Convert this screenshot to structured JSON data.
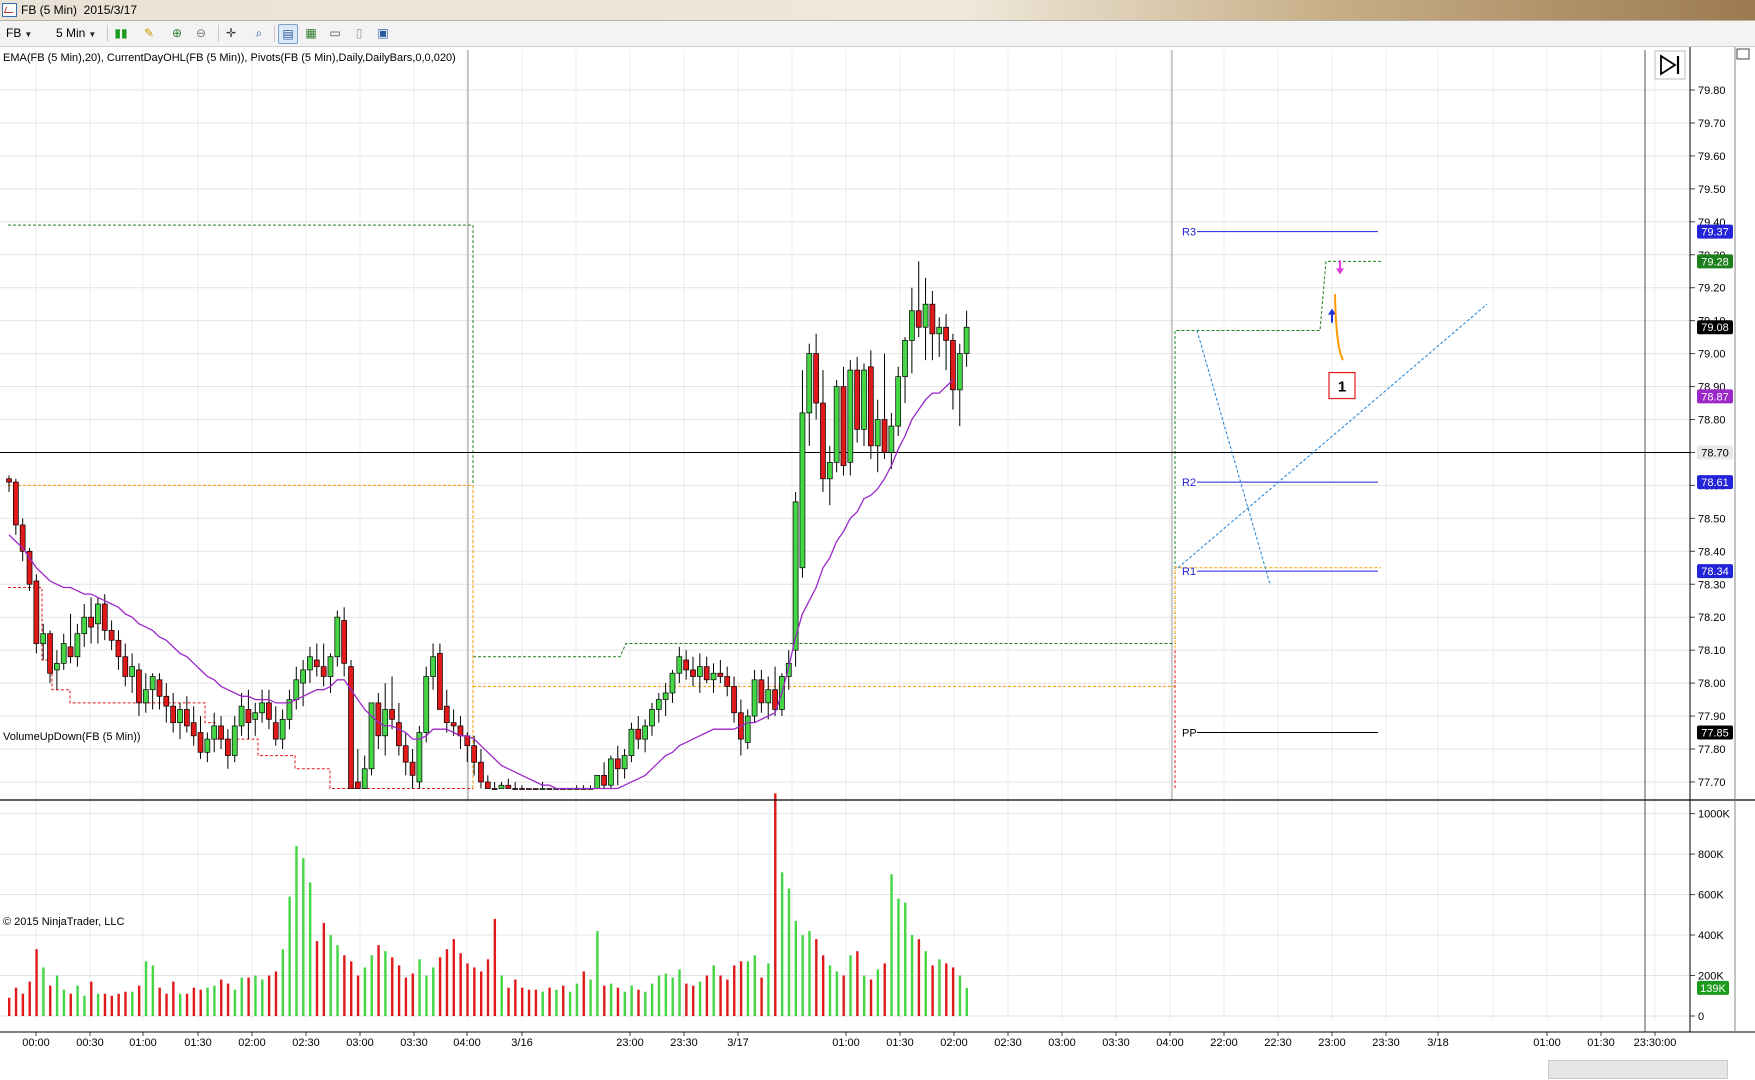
{
  "window": {
    "title": "FB (5 Min)  2015/3/17"
  },
  "toolbar": {
    "instrument": "FB",
    "interval": "5 Min",
    "icons": [
      "bars-type-icon",
      "draw-tool-icon",
      "zoom-in-icon",
      "zoom-out-icon",
      "crosshair-icon",
      "search-icon",
      "properties-icon",
      "tile-icon",
      "chart-trader-icon",
      "data-box-icon",
      "new-window-icon"
    ]
  },
  "price_panel": {
    "indicator_label": "EMA(FB (5 Min),20), CurrentDayOHL(FB (5 Min)), Pivots(FB (5 Min),Daily,DailyBars,0,0,020)"
  },
  "volume_panel": {
    "indicator_label": "VolumeUpDown(FB (5 Min))"
  },
  "copyright": "© 2015 NinjaTrader, LLC",
  "colors": {
    "up": "#44d644",
    "down": "#e0191b",
    "ema": "#9c27c9",
    "pivot": "#2323d9",
    "high_line": "#1b7f1b",
    "low_line": "#e0191b",
    "open_line": "#ff9a00",
    "trend": "#1b7fd6"
  },
  "chart_data": [
    {
      "type": "candlestick",
      "instrument": "FB",
      "interval": "5 Min",
      "ylim": [
        77.68,
        79.92
      ],
      "y_ticks": [
        "79.80",
        "79.70",
        "79.60",
        "79.50",
        "79.40",
        "79.30",
        "79.20",
        "79.10",
        "79.00",
        "78.90",
        "78.80",
        "78.70",
        "78.60",
        "78.50",
        "78.40",
        "78.30",
        "78.20",
        "78.10",
        "78.00",
        "77.90",
        "77.80",
        "77.70"
      ],
      "x_tick_labels": [
        "00:00",
        "00:30",
        "01:00",
        "01:30",
        "02:00",
        "02:30",
        "03:00",
        "03:30",
        "04:00",
        "3/16",
        "23:00",
        "23:30",
        "3/17",
        "01:00",
        "01:30",
        "02:00",
        "02:30",
        "03:00",
        "03:30",
        "04:00",
        "22:00",
        "22:30",
        "23:00",
        "23:30",
        "3/18",
        "01:00",
        "01:30",
        "23:30:00"
      ],
      "last_price": 79.08,
      "horizontal_line": 78.7,
      "pivots": [
        {
          "name": "R3",
          "value": 79.37
        },
        {
          "name": "R2",
          "value": 78.61
        },
        {
          "name": "R1",
          "value": 78.34
        },
        {
          "name": "PP",
          "value": 77.85
        }
      ],
      "current_day": {
        "high": 79.28,
        "open": 78.35
      },
      "ema_value": 78.87,
      "markers": [
        {
          "text": "1"
        }
      ],
      "bars": [
        [
          78.62,
          78.63,
          78.58,
          78.61
        ],
        [
          78.61,
          78.62,
          78.45,
          78.48
        ],
        [
          78.48,
          78.5,
          78.37,
          78.4
        ],
        [
          78.4,
          78.41,
          78.28,
          78.3
        ],
        [
          78.31,
          78.33,
          78.09,
          78.12
        ],
        [
          78.12,
          78.18,
          78.07,
          78.15
        ],
        [
          78.15,
          78.16,
          78.0,
          78.03
        ],
        [
          78.04,
          78.1,
          77.98,
          78.06
        ],
        [
          78.06,
          78.15,
          78.04,
          78.12
        ],
        [
          78.11,
          78.21,
          78.06,
          78.08
        ],
        [
          78.08,
          78.18,
          78.05,
          78.15
        ],
        [
          78.15,
          78.24,
          78.11,
          78.2
        ],
        [
          78.2,
          78.26,
          78.12,
          78.17
        ],
        [
          78.18,
          78.26,
          78.12,
          78.24
        ],
        [
          78.24,
          78.27,
          78.13,
          78.16
        ],
        [
          78.16,
          78.19,
          78.1,
          78.13
        ],
        [
          78.13,
          78.16,
          78.04,
          78.08
        ],
        [
          78.08,
          78.12,
          77.99,
          78.02
        ],
        [
          78.02,
          78.09,
          77.97,
          78.05
        ],
        [
          78.04,
          78.06,
          77.9,
          77.94
        ],
        [
          77.94,
          78.03,
          77.91,
          77.98
        ],
        [
          77.98,
          78.03,
          77.92,
          78.02
        ],
        [
          78.01,
          78.03,
          77.92,
          77.96
        ],
        [
          77.96,
          78.0,
          77.88,
          77.93
        ],
        [
          77.93,
          77.97,
          77.85,
          77.88
        ],
        [
          77.88,
          77.94,
          77.83,
          77.92
        ],
        [
          77.92,
          77.96,
          77.85,
          77.87
        ],
        [
          77.88,
          77.93,
          77.81,
          77.84
        ],
        [
          77.85,
          77.9,
          77.77,
          77.79
        ],
        [
          77.79,
          77.85,
          77.76,
          77.83
        ],
        [
          77.83,
          77.91,
          77.79,
          77.87
        ],
        [
          77.87,
          77.9,
          77.8,
          77.83
        ],
        [
          77.83,
          77.86,
          77.74,
          77.78
        ],
        [
          77.78,
          77.9,
          77.76,
          77.87
        ],
        [
          77.87,
          77.97,
          77.84,
          77.93
        ],
        [
          77.92,
          77.98,
          77.83,
          77.88
        ],
        [
          77.89,
          77.94,
          77.84,
          77.91
        ],
        [
          77.91,
          77.98,
          77.88,
          77.94
        ],
        [
          77.94,
          77.98,
          77.86,
          77.89
        ],
        [
          77.88,
          77.93,
          77.81,
          77.83
        ],
        [
          77.83,
          77.92,
          77.8,
          77.89
        ],
        [
          77.89,
          77.98,
          77.86,
          77.95
        ],
        [
          77.95,
          78.05,
          77.92,
          78.01
        ],
        [
          78.0,
          78.07,
          77.93,
          78.04
        ],
        [
          78.04,
          78.11,
          78.0,
          78.08
        ],
        [
          78.07,
          78.12,
          78.02,
          78.05
        ],
        [
          78.05,
          78.12,
          77.99,
          78.02
        ],
        [
          78.02,
          78.09,
          77.97,
          78.08
        ],
        [
          78.08,
          78.22,
          78.05,
          78.2
        ],
        [
          78.19,
          78.23,
          78.02,
          78.06
        ],
        [
          78.05,
          78.07,
          77.62,
          77.68
        ],
        [
          77.7,
          77.8,
          77.62,
          77.66
        ],
        [
          77.68,
          77.78,
          77.65,
          77.74
        ],
        [
          77.74,
          77.92,
          77.72,
          77.94
        ],
        [
          77.94,
          77.97,
          77.8,
          77.84
        ],
        [
          77.84,
          78.0,
          77.78,
          77.92
        ],
        [
          77.92,
          78.02,
          77.86,
          77.89
        ],
        [
          77.88,
          77.94,
          77.78,
          77.81
        ],
        [
          77.81,
          77.85,
          77.72,
          77.76
        ],
        [
          77.76,
          77.8,
          77.67,
          77.72
        ],
        [
          77.7,
          77.87,
          77.62,
          77.85
        ],
        [
          77.85,
          78.05,
          77.82,
          78.02
        ],
        [
          78.02,
          78.12,
          77.98,
          78.08
        ],
        [
          78.09,
          78.12,
          77.93,
          77.92
        ],
        [
          77.93,
          77.98,
          77.85,
          77.88
        ],
        [
          77.88,
          77.92,
          77.84,
          77.87
        ],
        [
          77.87,
          77.9,
          77.8,
          77.84
        ],
        [
          77.84,
          77.85,
          77.76,
          77.81
        ],
        [
          77.81,
          77.84,
          77.72,
          77.76
        ],
        [
          77.76,
          77.8,
          77.66,
          77.7
        ],
        [
          77.7,
          77.72,
          77.64,
          77.68
        ],
        [
          77.68,
          77.7,
          77.62,
          77.65
        ],
        [
          77.66,
          77.7,
          77.64,
          77.69
        ],
        [
          77.69,
          77.71,
          77.66,
          77.68
        ],
        [
          77.68,
          77.7,
          77.65,
          77.67
        ],
        [
          77.67,
          77.69,
          77.64,
          77.66
        ],
        [
          77.66,
          77.68,
          77.62,
          77.65
        ],
        [
          77.65,
          77.67,
          77.62,
          77.64
        ],
        [
          77.64,
          77.7,
          77.62,
          77.66
        ],
        [
          77.66,
          77.68,
          77.62,
          77.65
        ],
        [
          77.65,
          77.68,
          77.63,
          77.66
        ],
        [
          77.66,
          77.68,
          77.62,
          77.64
        ],
        [
          77.64,
          77.68,
          77.62,
          77.67
        ],
        [
          77.66,
          77.69,
          77.63,
          77.67
        ],
        [
          77.67,
          77.69,
          77.62,
          77.66
        ],
        [
          77.66,
          77.69,
          77.63,
          77.68
        ],
        [
          77.68,
          77.72,
          77.64,
          77.72
        ],
        [
          77.72,
          77.76,
          77.66,
          77.69
        ],
        [
          77.69,
          77.78,
          77.68,
          77.77
        ],
        [
          77.77,
          77.81,
          77.69,
          77.74
        ],
        [
          77.74,
          77.8,
          77.71,
          77.78
        ],
        [
          77.78,
          77.88,
          77.76,
          77.86
        ],
        [
          77.86,
          77.9,
          77.8,
          77.83
        ],
        [
          77.83,
          77.89,
          77.79,
          77.87
        ],
        [
          77.87,
          77.94,
          77.84,
          77.92
        ],
        [
          77.92,
          77.97,
          77.88,
          77.95
        ],
        [
          77.95,
          78.0,
          77.9,
          77.97
        ],
        [
          77.97,
          78.04,
          77.94,
          78.03
        ],
        [
          78.03,
          78.11,
          78.0,
          78.08
        ],
        [
          78.07,
          78.1,
          78.01,
          78.04
        ],
        [
          78.04,
          78.08,
          77.99,
          78.02
        ],
        [
          78.02,
          78.09,
          77.97,
          78.05
        ],
        [
          78.05,
          78.08,
          78.0,
          78.01
        ],
        [
          78.01,
          78.06,
          77.97,
          78.03
        ],
        [
          78.03,
          78.07,
          78.0,
          78.02
        ],
        [
          78.02,
          78.05,
          77.96,
          77.99
        ],
        [
          77.99,
          78.02,
          77.88,
          77.91
        ],
        [
          77.91,
          77.95,
          77.78,
          77.83
        ],
        [
          77.82,
          77.92,
          77.8,
          77.9
        ],
        [
          77.9,
          78.04,
          77.88,
          78.01
        ],
        [
          78.01,
          78.04,
          77.91,
          77.94
        ],
        [
          77.94,
          78.02,
          77.89,
          77.98
        ],
        [
          77.98,
          78.05,
          77.9,
          77.92
        ],
        [
          77.92,
          78.03,
          77.9,
          78.02
        ],
        [
          78.02,
          78.1,
          77.98,
          78.06
        ],
        [
          78.1,
          78.58,
          78.05,
          78.55
        ],
        [
          78.35,
          78.95,
          78.32,
          78.82
        ],
        [
          78.82,
          79.03,
          78.72,
          79.0
        ],
        [
          79.0,
          79.06,
          78.8,
          78.85
        ],
        [
          78.85,
          78.95,
          78.58,
          78.62
        ],
        [
          78.62,
          78.72,
          78.54,
          78.67
        ],
        [
          78.67,
          78.92,
          78.64,
          78.9
        ],
        [
          78.9,
          78.96,
          78.63,
          78.66
        ],
        [
          78.67,
          78.98,
          78.63,
          78.95
        ],
        [
          78.95,
          78.99,
          78.73,
          78.77
        ],
        [
          78.77,
          78.97,
          78.72,
          78.95
        ],
        [
          78.96,
          79.01,
          78.68,
          78.72
        ],
        [
          78.72,
          78.86,
          78.64,
          78.8
        ],
        [
          78.8,
          79.0,
          78.68,
          78.7
        ],
        [
          78.7,
          78.82,
          78.65,
          78.78
        ],
        [
          78.78,
          78.96,
          78.75,
          78.93
        ],
        [
          78.93,
          79.05,
          78.85,
          79.04
        ],
        [
          79.04,
          79.2,
          78.94,
          79.13
        ],
        [
          79.13,
          79.28,
          79.05,
          79.08
        ],
        [
          79.08,
          79.23,
          78.98,
          79.15
        ],
        [
          79.15,
          79.19,
          78.98,
          79.06
        ],
        [
          79.06,
          79.11,
          78.99,
          79.08
        ],
        [
          79.08,
          79.12,
          78.95,
          79.04
        ],
        [
          79.04,
          79.06,
          78.83,
          78.89
        ],
        [
          78.89,
          79.03,
          78.78,
          79.0
        ],
        [
          79.0,
          79.13,
          78.96,
          79.08
        ]
      ],
      "ema": [
        78.45,
        78.43,
        78.41,
        78.38,
        78.35,
        78.33,
        78.31,
        78.3,
        78.29,
        78.29,
        78.28,
        78.27,
        78.27,
        78.26,
        78.25,
        78.24,
        78.23,
        78.21,
        78.2,
        78.18,
        78.17,
        78.16,
        78.14,
        78.13,
        78.11,
        78.09,
        78.08,
        78.06,
        78.04,
        78.02,
        78.01,
        77.99,
        77.98,
        77.97,
        77.96,
        77.96,
        77.95,
        77.95,
        77.95,
        77.94,
        77.94,
        77.94,
        77.95,
        77.96,
        77.97,
        77.98,
        77.98,
        77.99,
        78.01,
        78.01,
        77.98,
        77.95,
        77.92,
        77.9,
        77.88,
        77.87,
        77.87,
        77.86,
        77.85,
        77.83,
        77.83,
        77.84,
        77.86,
        77.86,
        77.86,
        77.85,
        77.84,
        77.84,
        77.83,
        77.81,
        77.79,
        77.77,
        77.75,
        77.74,
        77.73,
        77.72,
        77.71,
        77.7,
        77.69,
        77.69,
        77.68,
        77.68,
        77.67,
        77.67,
        77.67,
        77.67,
        77.67,
        77.67,
        77.68,
        77.68,
        77.69,
        77.7,
        77.71,
        77.72,
        77.74,
        77.76,
        77.78,
        77.79,
        77.81,
        77.82,
        77.83,
        77.84,
        77.85,
        77.86,
        77.86,
        77.86,
        77.86,
        77.87,
        77.88,
        77.88,
        77.89,
        77.9,
        77.91,
        77.97,
        78.05,
        78.14,
        78.21,
        78.25,
        78.29,
        78.35,
        78.38,
        78.43,
        78.46,
        78.5,
        78.52,
        78.56,
        78.57,
        78.59,
        78.62,
        78.66,
        78.71,
        78.75,
        78.8,
        78.83,
        78.86,
        78.88,
        78.88,
        78.9,
        78.92
      ],
      "volume_ylim": [
        0,
        1100
      ],
      "volume_ticks": [
        "1000K",
        "800K",
        "600K",
        "400K",
        "200K",
        "0"
      ],
      "volume_last_label": "139K",
      "volume": [
        90,
        140,
        110,
        170,
        330,
        240,
        150,
        200,
        130,
        110,
        150,
        100,
        170,
        110,
        110,
        100,
        110,
        120,
        120,
        150,
        270,
        250,
        140,
        110,
        170,
        110,
        110,
        140,
        130,
        140,
        150,
        180,
        160,
        130,
        190,
        190,
        200,
        180,
        200,
        220,
        330,
        590,
        840,
        780,
        660,
        370,
        460,
        400,
        350,
        300,
        270,
        200,
        240,
        300,
        350,
        320,
        290,
        250,
        190,
        210,
        280,
        200,
        240,
        290,
        330,
        380,
        310,
        260,
        240,
        220,
        280,
        480,
        200,
        140,
        180,
        140,
        130,
        130,
        120,
        140,
        130,
        150,
        120,
        160,
        220,
        180,
        420,
        150,
        160,
        140,
        120,
        150,
        130,
        120,
        160,
        200,
        210,
        190,
        230,
        160,
        150,
        170,
        200,
        250,
        200,
        180,
        250,
        270,
        270,
        300,
        190,
        260,
        1100,
        710,
        630,
        470,
        400,
        420,
        380,
        300,
        250,
        220,
        200,
        300,
        320,
        200,
        180,
        230,
        260,
        700,
        580,
        560,
        400,
        380,
        320,
        250,
        280,
        260,
        240,
        200,
        139
      ]
    }
  ]
}
